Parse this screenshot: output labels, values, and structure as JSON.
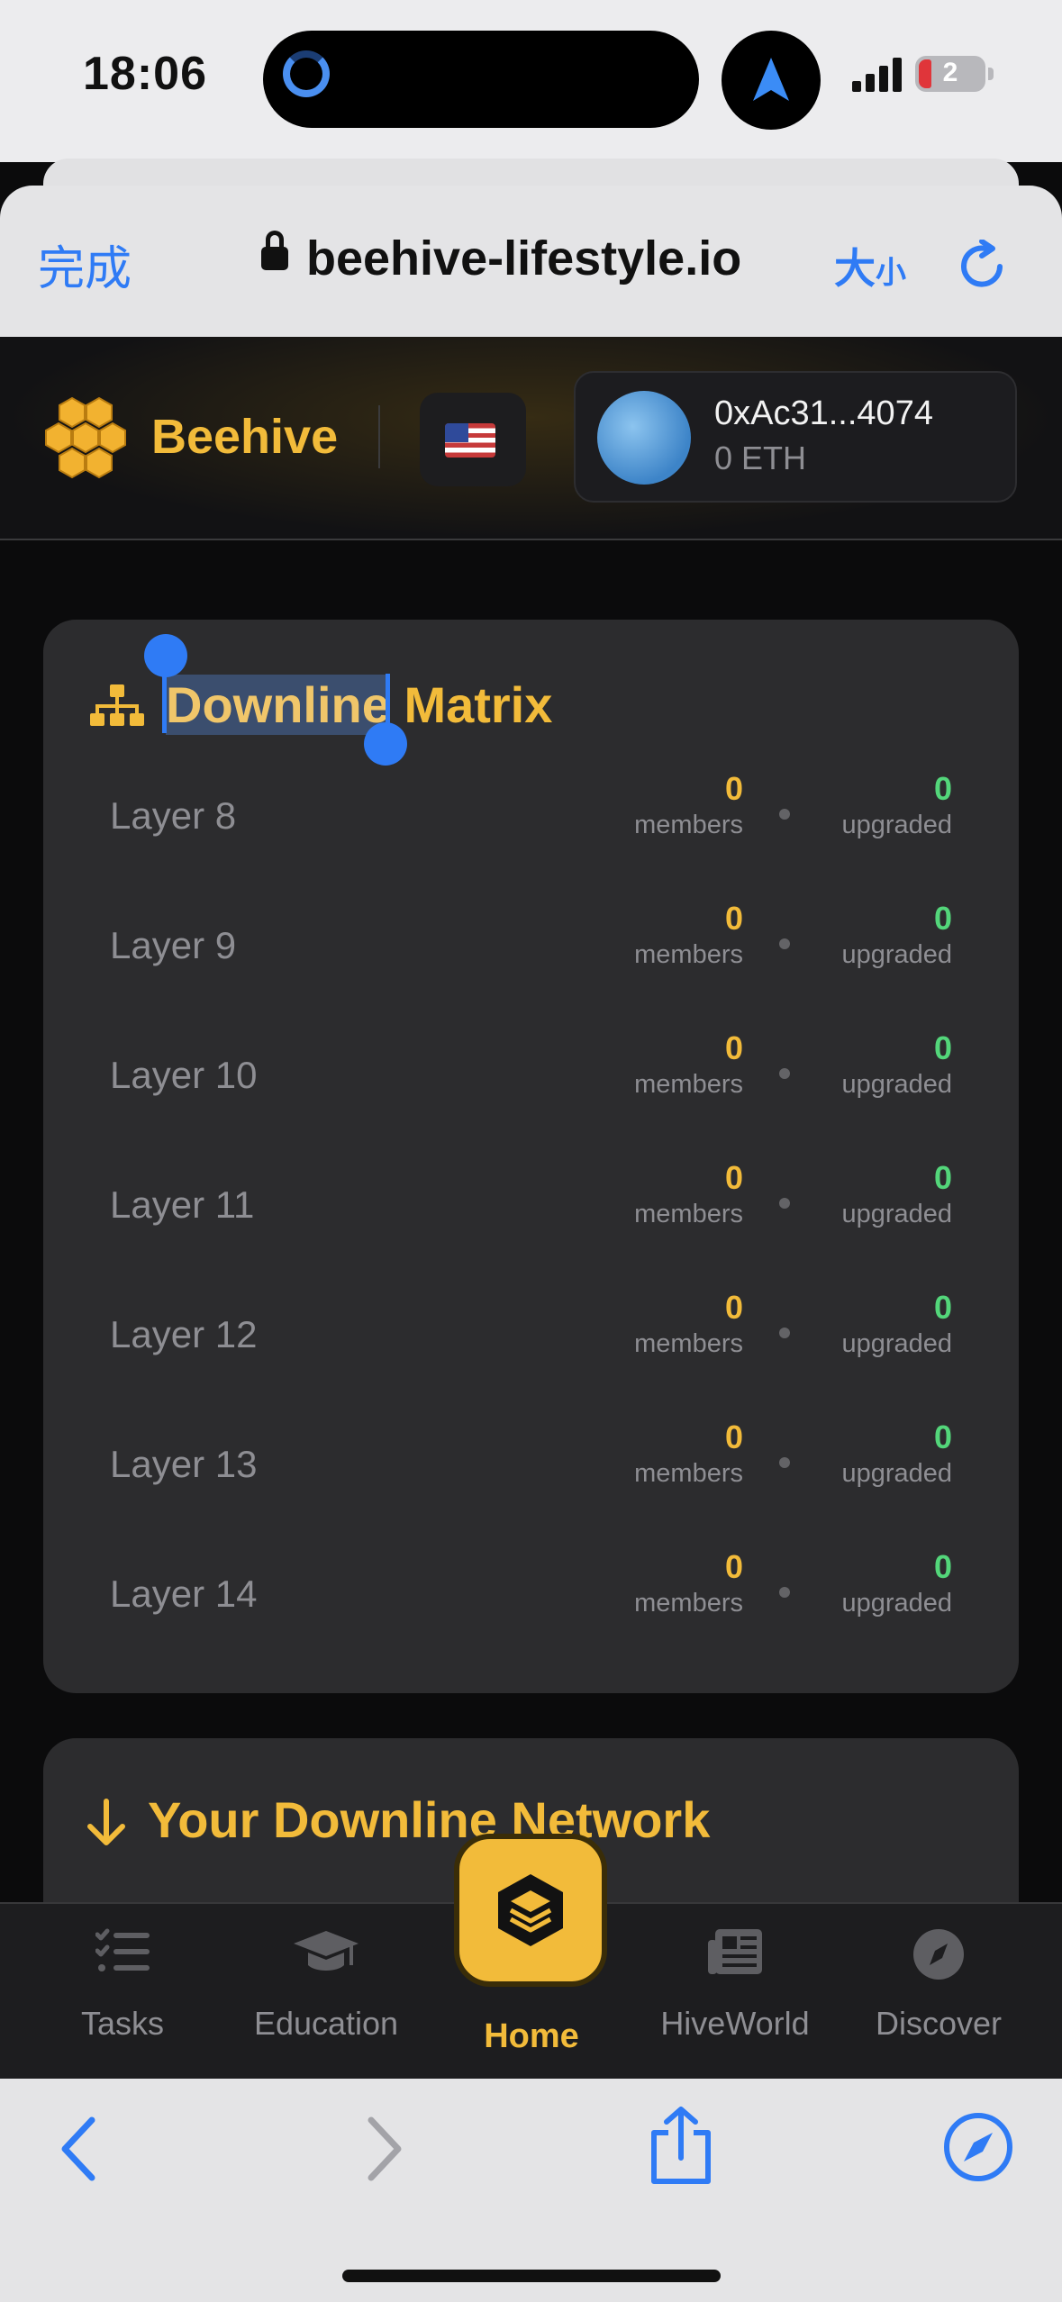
{
  "status_bar": {
    "time": "18:06",
    "battery": "2"
  },
  "browser": {
    "done_label": "完成",
    "url": "beehive-lifestyle.io",
    "text_size_large": "大",
    "text_size_small": "小"
  },
  "header": {
    "brand": "Beehive",
    "language_flag": "us-flag-icon",
    "wallet": {
      "address": "0xAc31...4074",
      "balance": "0 ETH"
    }
  },
  "matrix": {
    "title_selected": "Downline",
    "title_rest": " Matrix",
    "members_label": "members",
    "upgraded_label": "upgraded",
    "layers": [
      {
        "name": "Layer 8",
        "members": "0",
        "upgraded": "0"
      },
      {
        "name": "Layer 9",
        "members": "0",
        "upgraded": "0"
      },
      {
        "name": "Layer 10",
        "members": "0",
        "upgraded": "0"
      },
      {
        "name": "Layer 11",
        "members": "0",
        "upgraded": "0"
      },
      {
        "name": "Layer 12",
        "members": "0",
        "upgraded": "0"
      },
      {
        "name": "Layer 13",
        "members": "0",
        "upgraded": "0"
      },
      {
        "name": "Layer 14",
        "members": "0",
        "upgraded": "0"
      }
    ]
  },
  "network": {
    "title": "Your Downline Network"
  },
  "bottom_nav": {
    "items": [
      {
        "label": "Tasks",
        "icon": "tasks-icon"
      },
      {
        "label": "Education",
        "icon": "graduation-cap-icon"
      },
      {
        "label": "Home",
        "icon": "layers-icon",
        "active": true
      },
      {
        "label": "HiveWorld",
        "icon": "newspaper-icon"
      },
      {
        "label": "Discover",
        "icon": "compass-icon"
      }
    ]
  },
  "colors": {
    "accent": "#f2bb3a",
    "upgraded": "#53d67a",
    "ios_blue": "#2f7bf5",
    "card": "#2c2c2e"
  }
}
